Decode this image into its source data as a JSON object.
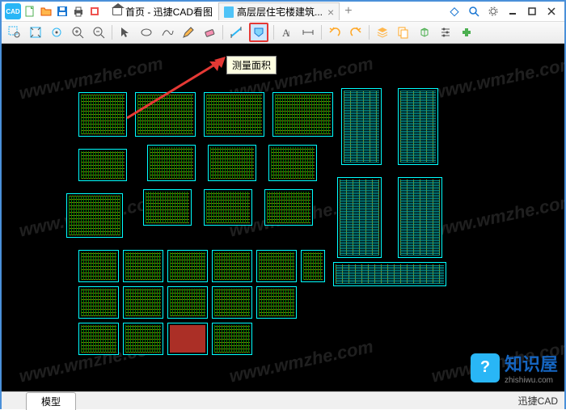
{
  "app": {
    "name": "迅捷CAD看图"
  },
  "tabs": {
    "home": "首页 - 迅捷CAD看图",
    "doc": "高层层住宅楼建筑...",
    "close": "×",
    "add": "+"
  },
  "tooltip": {
    "measure_area": "测量面积"
  },
  "statusbar": {
    "model": "模型",
    "right": "迅捷CAD"
  },
  "watermark": "www.wmzhe.com",
  "brand": {
    "name": "知识屋",
    "sub": "zhishiwu.com",
    "icon": "?"
  },
  "titlebar_icons": [
    "new",
    "open",
    "save",
    "print",
    "recent"
  ],
  "win_icons": [
    "diamond",
    "search",
    "settings",
    "minimize",
    "maximize",
    "close"
  ],
  "toolbar_icons": [
    "zoom-window",
    "zoom-extents",
    "pan",
    "zoom-in",
    "zoom-out",
    "sep",
    "pointer",
    "ellipse",
    "spline",
    "pencil",
    "eraser",
    "sep",
    "measure-dist",
    "measure-area",
    "sep",
    "text",
    "dimension",
    "sep",
    "undo",
    "redo",
    "sep",
    "layer",
    "copy",
    "3d",
    "settings2",
    "plugin"
  ]
}
